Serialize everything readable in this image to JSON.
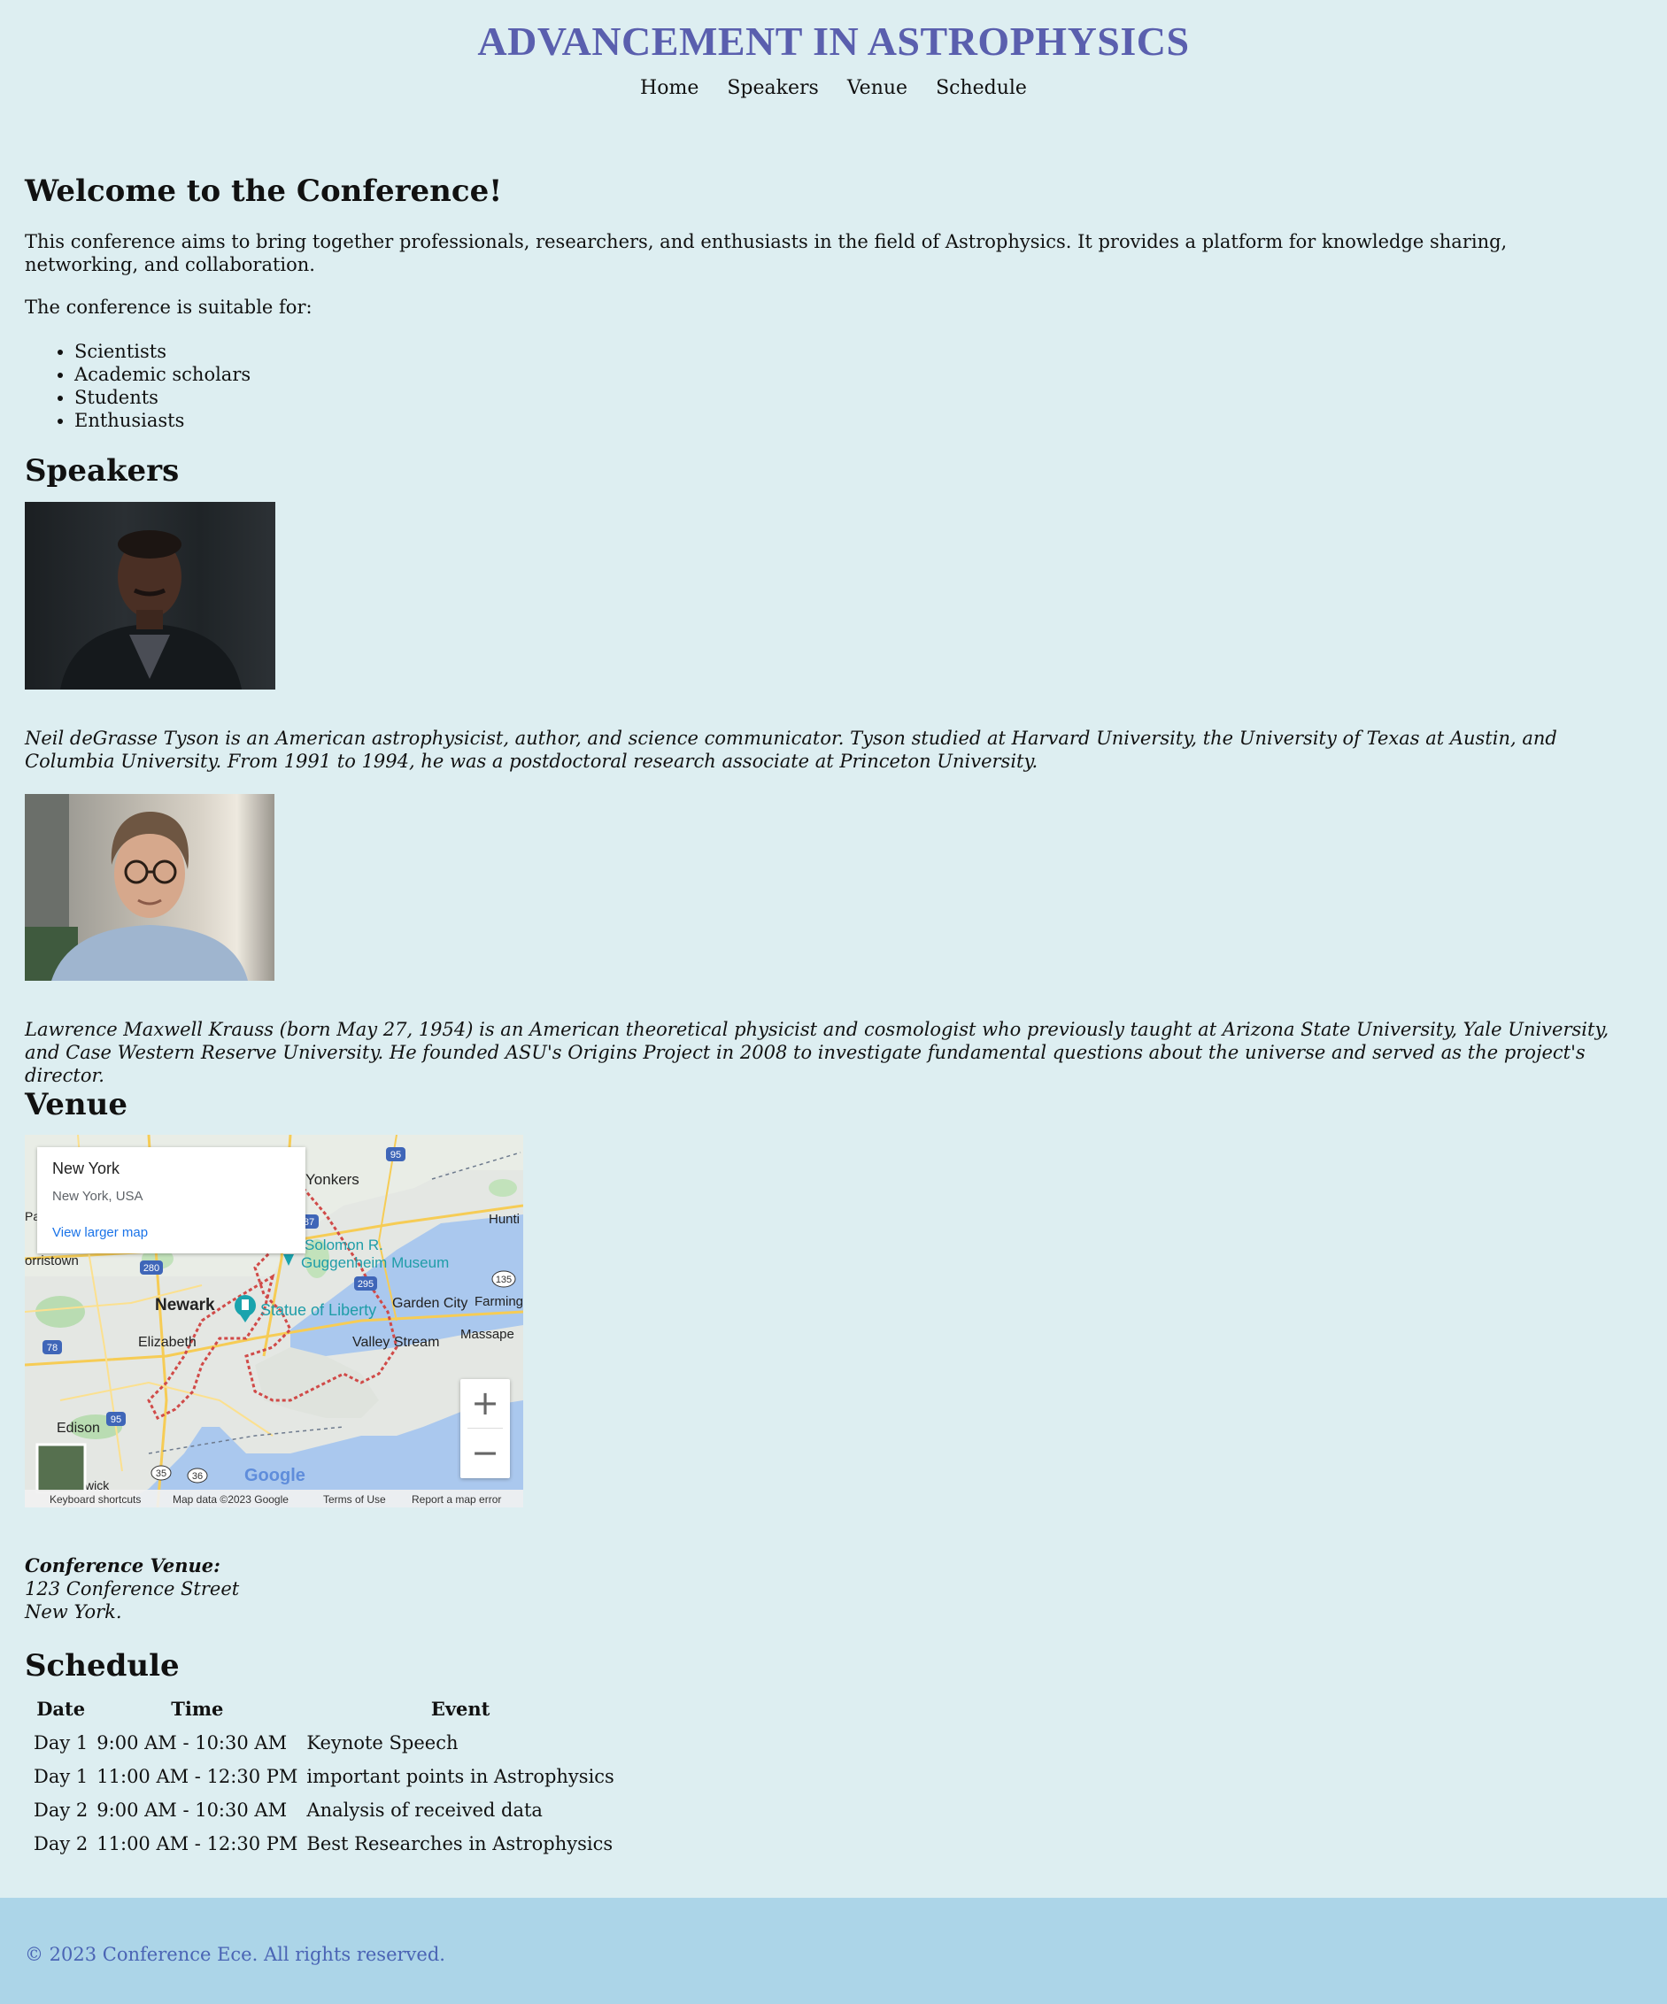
{
  "header": {
    "title": "ADVANCEMENT IN ASTROPHYSICS",
    "nav": [
      "Home",
      "Speakers",
      "Venue",
      "Schedule"
    ]
  },
  "welcome": {
    "title": "Welcome to the Conference!",
    "intro": "This conference aims to bring together professionals, researchers, and enthusiasts in the field of Astrophysics. It provides a platform for knowledge sharing, networking, and collaboration.",
    "suitable": "The conference is suitable for:",
    "audience": [
      "Scientists",
      "Academic scholars",
      "Students",
      "Enthusiasts"
    ]
  },
  "speakers": {
    "title": "Speakers",
    "items": [
      {
        "bio": "Neil deGrasse Tyson is an American astrophysicist, author, and science communicator. Tyson studied at Harvard University, the University of Texas at Austin, and Columbia University. From 1991 to 1994, he was a postdoctoral research associate at Princeton University."
      },
      {
        "bio": "Lawrence Maxwell Krauss (born May 27, 1954) is an American theoretical physicist and cosmologist who previously taught at Arizona State University, Yale University, and Case Western Reserve University. He founded ASU's Origins Project in 2008 to investigate fundamental questions about the universe and served as the project's director."
      }
    ]
  },
  "venue": {
    "title": "Venue",
    "map": {
      "card_title": "New York",
      "card_subtitle": "New York, USA",
      "card_link": "View larger map",
      "labels": [
        "Yonkers",
        "Solomon R.",
        "Guggenheim Museum",
        "Statue of Liberty",
        "Newark",
        "Elizabeth",
        "Garden City",
        "Valley Stream",
        "Farming",
        "Massape",
        "Hunti",
        "orristown",
        "Edison",
        "wick",
        "Pa"
      ],
      "shields": [
        "95",
        "87",
        "280",
        "295",
        "135",
        "78",
        "95",
        "35",
        "36"
      ],
      "zoom_in": "+",
      "zoom_out": "−",
      "google": "Google",
      "attribution": [
        "Keyboard shortcuts",
        "Map data ©2023 Google",
        "Terms of Use",
        "Report a map error"
      ]
    },
    "label": "Conference Venue:",
    "line1": "123 Conference Street",
    "line2": "New York."
  },
  "schedule": {
    "title": "Schedule",
    "headers": [
      "Date",
      "Time",
      "Event"
    ],
    "rows": [
      [
        "Day 1",
        "9:00 AM - 10:30 AM",
        "Keynote Speech"
      ],
      [
        "Day 1",
        "11:00 AM - 12:30 PM",
        "important points in Astrophysics"
      ],
      [
        "Day 2",
        "9:00 AM - 10:30 AM",
        "Analysis of received data"
      ],
      [
        "Day 2",
        "11:00 AM - 12:30 PM",
        "Best Researches in Astrophysics"
      ]
    ]
  },
  "footer": {
    "copyright": "© 2023 Conference Ece. All rights reserved."
  }
}
